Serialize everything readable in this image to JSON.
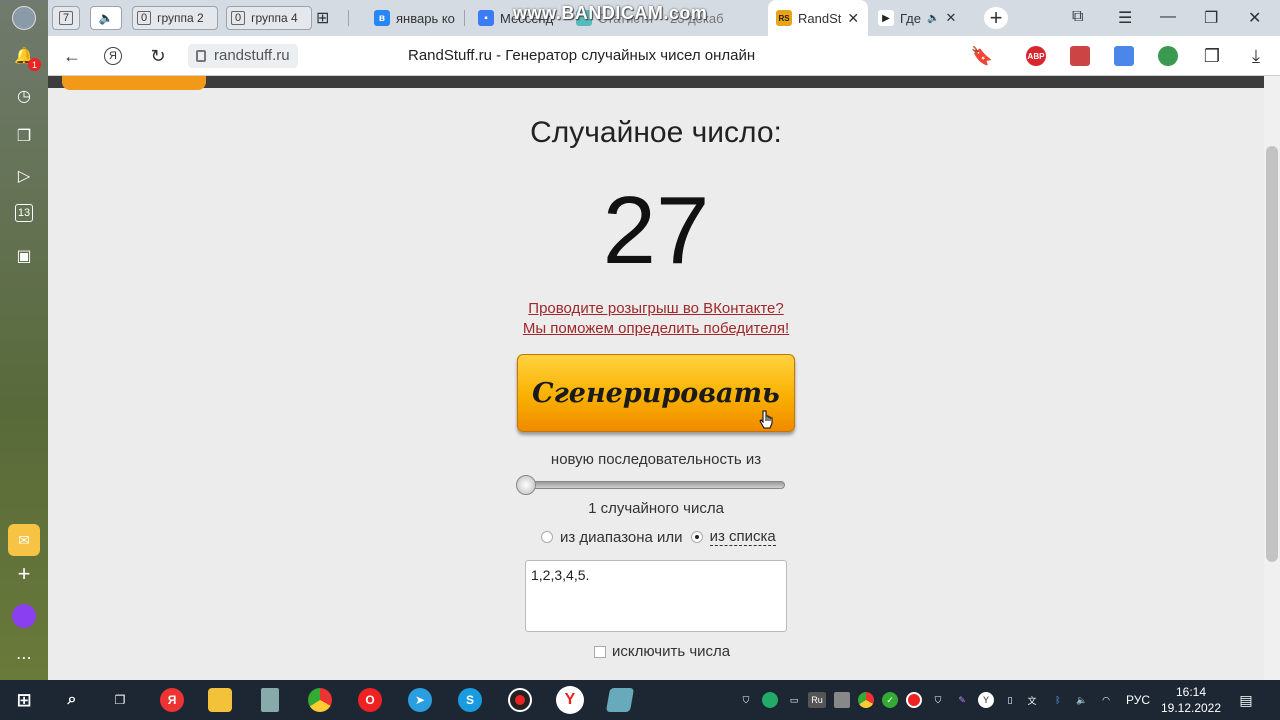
{
  "browser": {
    "pinned_tabs": [
      {
        "count": "7",
        "label": ""
      },
      {
        "count": "0",
        "label": "группа 2"
      },
      {
        "count": "0",
        "label": "группа 4"
      }
    ],
    "tabs": [
      {
        "label": "январь ко"
      },
      {
        "label": "Мессенд"
      },
      {
        "label": "Статисти"
      },
      {
        "label": "23 декаб"
      },
      {
        "label": "RandSt"
      },
      {
        "label": "Где"
      }
    ],
    "watermark": "www.BANDICAM.com",
    "address": {
      "domain": "randstuff.ru",
      "page_title": "RandStuff.ru - Генератор случайных чисел онлайн",
      "yandex_glyph": "Я"
    },
    "extensions": [
      "ABP"
    ],
    "notification_count": "1",
    "sidebar_badge": "13"
  },
  "page": {
    "title": "Случайное число:",
    "result": "27",
    "vk_line1": "Проводите розыгрыш во ВКонтакте?",
    "vk_line2": "Мы поможем определить победителя!",
    "generate_label": "Сгенерировать",
    "sequence_label": "новую последовательность из",
    "count_label": "1 случайного числа",
    "radio_range_label": "из диапазона или",
    "radio_list_label": "из списка",
    "list_value": "1,2,3,4,5.",
    "exclude_label": "исключить числа",
    "selected_mode": "list",
    "slider_value": "1"
  },
  "taskbar": {
    "lang": "РУС",
    "time": "16:14",
    "date": "19.12.2022",
    "tray_ru": "Ru"
  },
  "colors": {
    "accent": "#f9b000",
    "link": "#a0282a"
  }
}
